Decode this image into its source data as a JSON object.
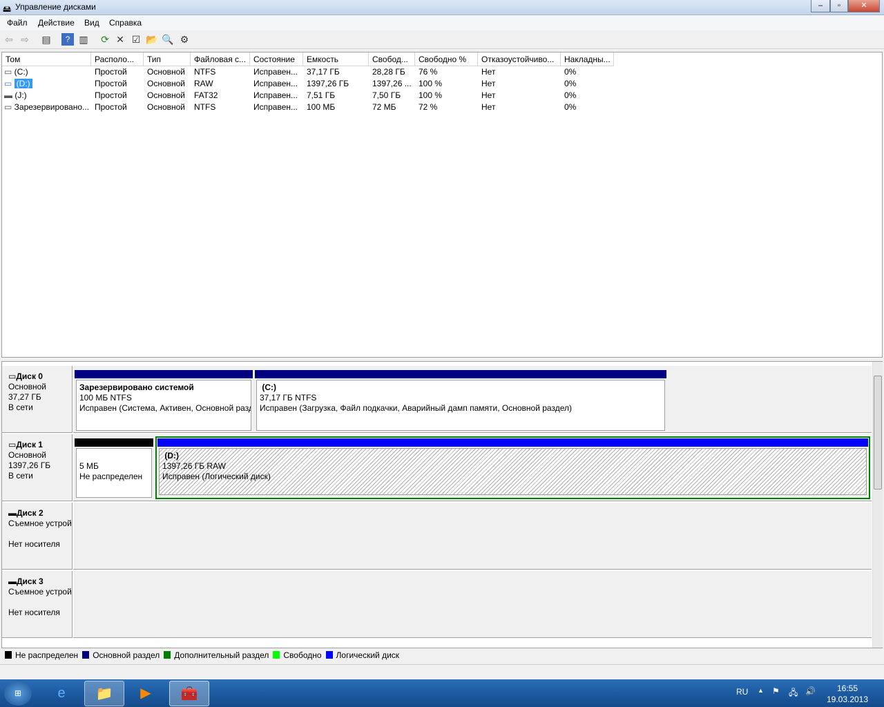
{
  "window": {
    "title": "Управление дисками"
  },
  "menu": [
    "Файл",
    "Действие",
    "Вид",
    "Справка"
  ],
  "toolbar": [
    "back-icon",
    "forward-icon",
    "console-tree-icon",
    "help-icon",
    "action-pane-icon",
    "refresh-icon",
    "delete-icon",
    "properties-icon",
    "open-icon",
    "search-icon",
    "settings-icon"
  ],
  "volumes": {
    "headers": [
      "Том",
      "Располо...",
      "Тип",
      "Файловая с...",
      "Состояние",
      "Емкость",
      "Свобод...",
      "Свободно %",
      "Отказоустойчиво...",
      "Накладны..."
    ],
    "rows": [
      [
        "(C:)",
        "Простой",
        "Основной",
        "NTFS",
        "Исправен...",
        "37,17 ГБ",
        "28,28 ГБ",
        "76 %",
        "Нет",
        "0%"
      ],
      [
        "(D:)",
        "Простой",
        "Основной",
        "RAW",
        "Исправен...",
        "1397,26 ГБ",
        "1397,26 ...",
        "100 %",
        "Нет",
        "0%"
      ],
      [
        "(J:)",
        "Простой",
        "Основной",
        "FAT32",
        "Исправен...",
        "7,51 ГБ",
        "7,50 ГБ",
        "100 %",
        "Нет",
        "0%"
      ],
      [
        "Зарезервировано...",
        "Простой",
        "Основной",
        "NTFS",
        "Исправен...",
        "100 МБ",
        "72 МБ",
        "72 %",
        "Нет",
        "0%"
      ]
    ],
    "selected_row": 1
  },
  "disks": [
    {
      "name": "Диск 0",
      "type": "Основной",
      "size": "37,27 ГБ",
      "status": "В сети",
      "partitions": [
        {
          "title": "Зарезервировано системой",
          "size": "100 МБ NTFS",
          "status": "Исправен (Система, Активен, Основной раздел)"
        },
        {
          "title": "(C:)",
          "size": "37,17 ГБ NTFS",
          "status": "Исправен (Загрузка, Файл подкачки, Аварийный дамп памяти, Основной раздел)"
        }
      ]
    },
    {
      "name": "Диск 1",
      "type": "Основной",
      "size": "1397,26 ГБ",
      "status": "В сети",
      "partitions": [
        {
          "title": "",
          "size": "5 МБ",
          "status": "Не распределен"
        },
        {
          "title": "(D:)",
          "size": "1397,26 ГБ RAW",
          "status": "Исправен (Логический диск)"
        }
      ]
    },
    {
      "name": "Диск 2",
      "type": "Съемное устройство",
      "status": "Нет носителя"
    },
    {
      "name": "Диск 3",
      "type": "Съемное устройство",
      "status": "Нет носителя"
    }
  ],
  "legend": [
    {
      "label": "Не распределен",
      "color": "#000000"
    },
    {
      "label": "Основной раздел",
      "color": "#000080"
    },
    {
      "label": "Дополнительный раздел",
      "color": "#008000"
    },
    {
      "label": "Свободно",
      "color": "#00ff00"
    },
    {
      "label": "Логический диск",
      "color": "#0000ff"
    }
  ],
  "taskbar": {
    "lang": "RU",
    "time": "16:55",
    "date": "19.03.2013"
  }
}
